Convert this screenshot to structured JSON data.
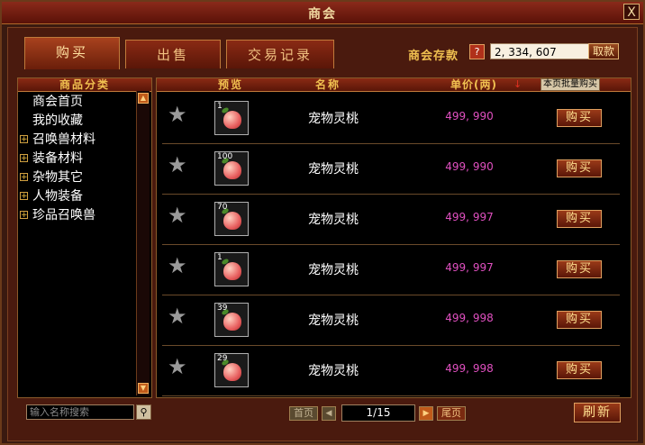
{
  "window": {
    "title": "商会",
    "close_glyph": "X"
  },
  "tabs": [
    {
      "label": "购买",
      "active": true
    },
    {
      "label": "出售",
      "active": false
    },
    {
      "label": "交易记录",
      "active": false
    }
  ],
  "balance": {
    "label": "商会存款",
    "help": "?",
    "value": "2, 334, 607",
    "withdraw_label": "取款"
  },
  "categories": {
    "header": "商品分类",
    "items": [
      {
        "label": "商会首页",
        "expandable": false
      },
      {
        "label": "我的收藏",
        "expandable": false
      },
      {
        "label": "召唤兽材料",
        "expandable": true
      },
      {
        "label": "装备材料",
        "expandable": true
      },
      {
        "label": "杂物其它",
        "expandable": true
      },
      {
        "label": "人物装备",
        "expandable": true
      },
      {
        "label": "珍品召唤兽",
        "expandable": true
      }
    ]
  },
  "search": {
    "placeholder": "输入名称搜索"
  },
  "list": {
    "headers": {
      "preview": "预览",
      "name": "名称",
      "price": "单价(两)",
      "batch_buy": "本页批量购买"
    },
    "buy_label": "购买",
    "rows": [
      {
        "qty": "1",
        "name": "宠物灵桃",
        "price": "499, 990"
      },
      {
        "qty": "100",
        "name": "宠物灵桃",
        "price": "499, 990"
      },
      {
        "qty": "70",
        "name": "宠物灵桃",
        "price": "499, 997"
      },
      {
        "qty": "1",
        "name": "宠物灵桃",
        "price": "499, 997"
      },
      {
        "qty": "39",
        "name": "宠物灵桃",
        "price": "499, 998"
      },
      {
        "qty": "29",
        "name": "宠物灵桃",
        "price": "499, 998"
      }
    ]
  },
  "pagination": {
    "first": "首页",
    "last": "尾页",
    "page": "1/15"
  },
  "refresh_label": "刷新"
}
